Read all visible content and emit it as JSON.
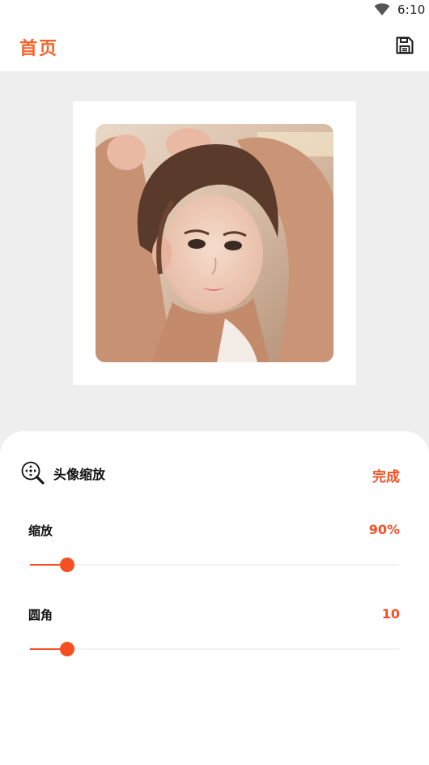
{
  "status_bar": {
    "time": "6:10",
    "wifi_icon": "wifi-icon"
  },
  "app_bar": {
    "title": "首页",
    "save_icon": "save-icon"
  },
  "preview": {
    "image_description_icon": "avatar-photo"
  },
  "sheet": {
    "icon": "zoom-search-icon",
    "title": "头像缩放",
    "done_label": "完成",
    "rows": [
      {
        "label": "缩放",
        "value": "90%",
        "fraction": 0.1
      },
      {
        "label": "圆角",
        "value": "10",
        "fraction": 0.1
      }
    ]
  },
  "colors": {
    "accent": "#f55024",
    "title_orange": "#f5642a",
    "preview_bg": "#eeeeee"
  }
}
